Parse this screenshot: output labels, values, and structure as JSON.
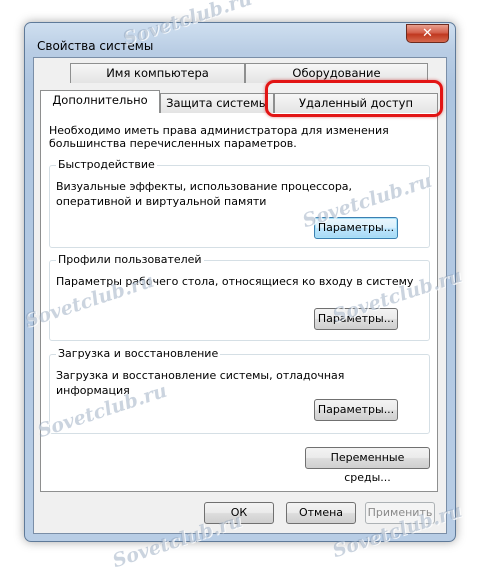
{
  "window": {
    "title": "Свойства системы",
    "close_label": "✕"
  },
  "tabs": {
    "row_back": [
      {
        "label": "Имя компьютера"
      },
      {
        "label": "Оборудование"
      }
    ],
    "row_front": [
      {
        "label": "Дополнительно",
        "active": true
      },
      {
        "label": "Защита системы"
      },
      {
        "label": "Удаленный доступ"
      }
    ]
  },
  "panel": {
    "intro": "Необходимо иметь права администратора для изменения большинства перечисленных параметров.",
    "groups": [
      {
        "title": "Быстродействие",
        "desc": "Визуальные эффекты, использование процессора, оперативной и виртуальной памяти",
        "button": "Параметры..."
      },
      {
        "title": "Профили пользователей",
        "desc": "Параметры рабочего стола, относящиеся ко входу в систему",
        "button": "Параметры..."
      },
      {
        "title": "Загрузка и восстановление",
        "desc": "Загрузка и восстановление системы, отладочная информация",
        "button": "Параметры..."
      }
    ],
    "env_button": "Переменные среды..."
  },
  "footer": {
    "ok": "ОК",
    "cancel": "Отмена",
    "apply": "Применить"
  },
  "watermark": {
    "text": "Sovetclub.ru"
  },
  "colors": {
    "highlight": "#e21414",
    "focus_border": "#3c7fb1"
  }
}
